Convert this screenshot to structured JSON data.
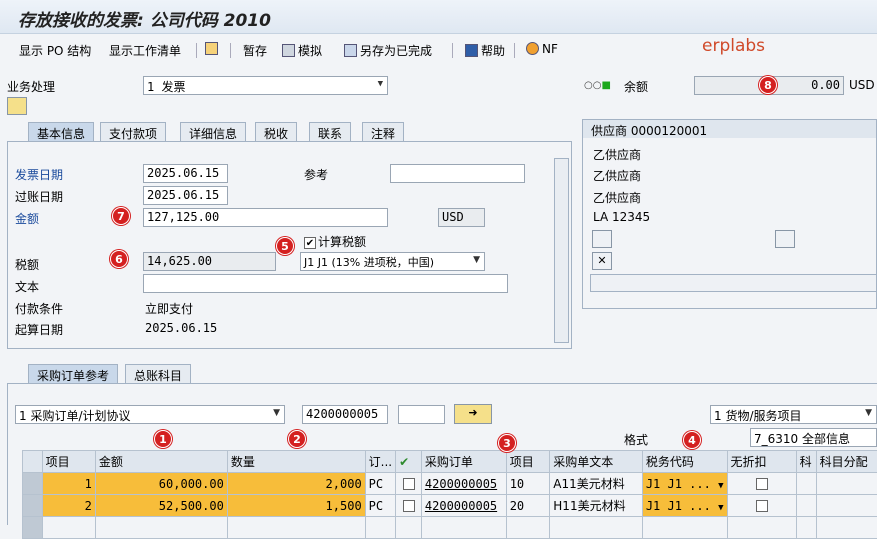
{
  "title": "存放接收的发票: 公司代码 2010",
  "watermark": "erplabs",
  "toolbar": {
    "show_po_structure": "显示 PO 结构",
    "show_worklist": "显示工作清单",
    "hold": "暂存",
    "simulate": "模拟",
    "save_completed": "另存为已完成",
    "help": "帮助",
    "nf": "NF"
  },
  "transaction": {
    "label": "业务处理",
    "value": "1 发票"
  },
  "balance": {
    "label": "余额",
    "value": "0.00",
    "currency": "USD"
  },
  "tabs_top": [
    "基本信息",
    "支付款项",
    "详细信息",
    "税收",
    "联系",
    "注释"
  ],
  "basic": {
    "invoice_date_label": "发票日期",
    "invoice_date": "2025.06.15",
    "reference_label": "参考",
    "reference": "",
    "posting_date_label": "过账日期",
    "posting_date": "2025.06.15",
    "amount_label": "金额",
    "amount": "127,125.00",
    "amount_currency": "USD",
    "calc_tax_label": "计算税额",
    "tax_label": "税额",
    "tax_amount": "14,625.00",
    "tax_code": "J1 J1 (13% 进项税，中国)",
    "text_label": "文本",
    "text": "",
    "payment_terms_label": "付款条件",
    "payment_terms": "立即支付",
    "baseline_date_label": "起算日期",
    "baseline_date": "2025.06.15"
  },
  "vendor": {
    "header": "供应商 0000120001",
    "line1": "乙供应商",
    "line2": "乙供应商",
    "line3": "乙供应商",
    "line4": "LA  12345"
  },
  "tabs_bottom": [
    "采购订单参考",
    "总账科目"
  ],
  "reference": {
    "type": "1 采购订单/计划协议",
    "po_number": "4200000005",
    "extra": "",
    "item_type": "1 货物/服务项目",
    "layout_label": "格式",
    "layout": "7_6310 全部信息"
  },
  "grid": {
    "headers": [
      "项目",
      "金额",
      "数量",
      "订...",
      "",
      "采购订单",
      "项目",
      "采购单文本",
      "税务代码",
      "无折扣",
      "科",
      "科目分配"
    ],
    "rows": [
      {
        "item": "1",
        "amount": "60,000.00",
        "qty": "2,000",
        "unit": "PC",
        "po": "4200000005",
        "po_item": "10",
        "text": "A11美元材料",
        "tax": "J1 J1 ..."
      },
      {
        "item": "2",
        "amount": "52,500.00",
        "qty": "1,500",
        "unit": "PC",
        "po": "4200000005",
        "po_item": "20",
        "text": "H11美元材料",
        "tax": "J1 J1 ..."
      }
    ]
  },
  "badges": [
    "1",
    "2",
    "3",
    "4",
    "5",
    "6",
    "7",
    "8"
  ]
}
